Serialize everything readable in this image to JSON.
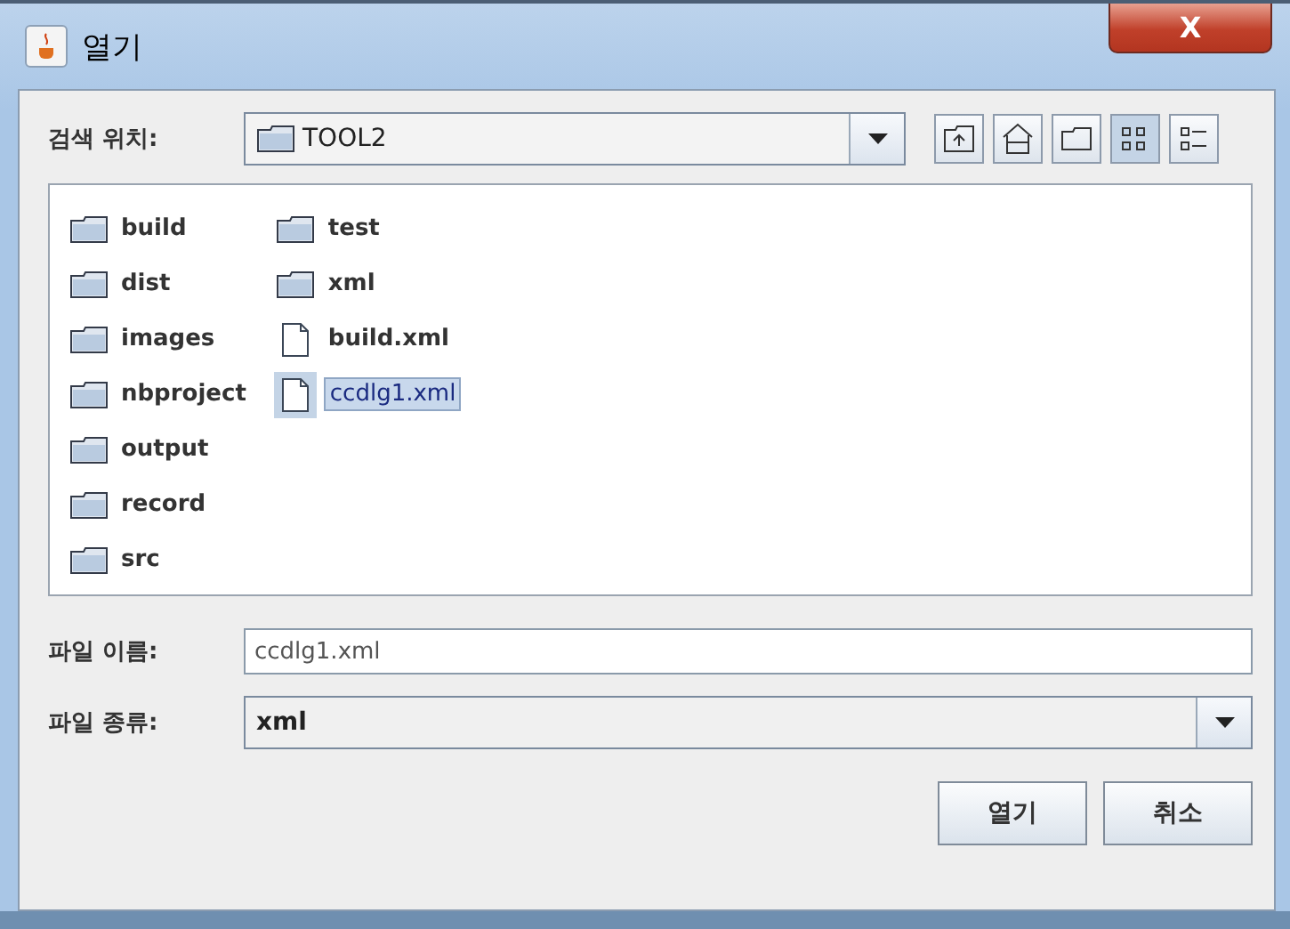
{
  "window": {
    "title": "열기",
    "close": "X"
  },
  "look_in": {
    "label": "검색 위치:",
    "value": "TOOL2"
  },
  "view_buttons": [
    {
      "kind": "list",
      "selected": true
    },
    {
      "kind": "details",
      "selected": false
    }
  ],
  "files": [
    {
      "name": "build",
      "kind": "folder",
      "selected": false
    },
    {
      "name": "dist",
      "kind": "folder",
      "selected": false
    },
    {
      "name": "images",
      "kind": "folder",
      "selected": false
    },
    {
      "name": "nbproject",
      "kind": "folder",
      "selected": false
    },
    {
      "name": "output",
      "kind": "folder",
      "selected": false
    },
    {
      "name": "record",
      "kind": "folder",
      "selected": false
    },
    {
      "name": "src",
      "kind": "folder",
      "selected": false
    },
    {
      "name": "test",
      "kind": "folder",
      "selected": false
    },
    {
      "name": "xml",
      "kind": "folder",
      "selected": false
    },
    {
      "name": "build.xml",
      "kind": "file",
      "selected": false
    },
    {
      "name": "ccdlg1.xml",
      "kind": "file",
      "selected": true
    }
  ],
  "file_name": {
    "label": "파일 이름:",
    "value": "ccdlg1.xml"
  },
  "file_type": {
    "label": "파일 종류:",
    "value": "xml"
  },
  "buttons": [
    "열기",
    "취소"
  ]
}
